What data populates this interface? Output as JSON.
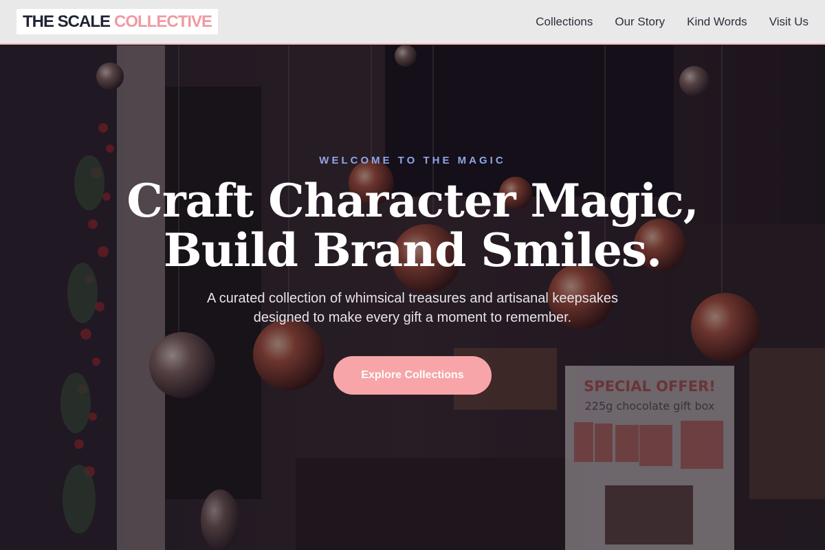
{
  "header": {
    "logo_part1": "THE SCALE",
    "logo_part2": "COLLECTIVE",
    "nav": [
      "Collections",
      "Our Story",
      "Kind Words",
      "Visit Us"
    ]
  },
  "hero": {
    "eyebrow": "WELCOME TO THE MAGIC",
    "title_line1": "Craft Character Magic,",
    "title_line2": "Build Brand Smiles.",
    "subtitle": "A curated collection of whimsical treasures and artisanal keepsakes designed to make every gift a moment to remember.",
    "cta": "Explore Collections",
    "sign_line1": "SPECIAL OFFER!",
    "sign_line2": "225g chocolate gift box"
  },
  "colors": {
    "accent": "#f7a5a8",
    "logo_dark": "#1f2433",
    "logo_pink": "#f09aa3",
    "eyebrow": "#8fa6e8"
  }
}
